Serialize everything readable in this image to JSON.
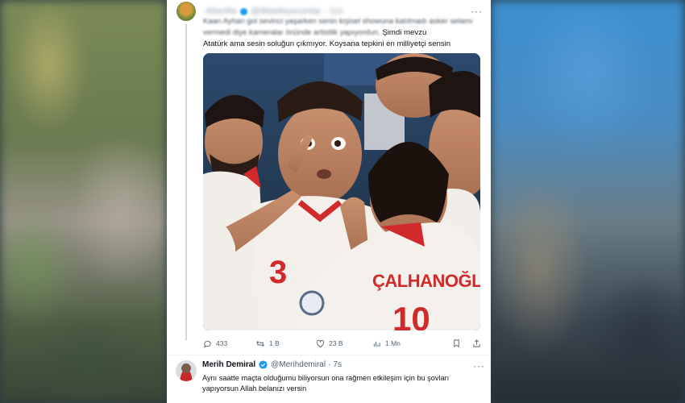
{
  "tweet1": {
    "author_blurred": "AltanRe",
    "handle_blurred": "@ilkbelleyorumlar · 11s",
    "text_blurred": "Kaan Ayhan gol sevinci yaşarken senin kişisel showuna katılmadı asker selamı vermedi diye kameralar önünde artistlik yapıyordun.",
    "text_line3_rest": "Şimdi mevzu",
    "text_line4": "Atatürk ama sesin soluğun çıkmıyor. Koysana tepkini en milliyetçi sensin",
    "media": {
      "jersey_numbers": [
        "3",
        "10"
      ],
      "jersey_name": "ÇALHANOĞLU"
    },
    "actions": {
      "replies": "433",
      "reposts": "1 B",
      "likes": "23 B",
      "views": "1 Mn"
    }
  },
  "tweet2": {
    "name": "Merih Demiral",
    "handle": "@Merihdemiral",
    "separator": "·",
    "time": "7s",
    "text": "Aynı saatte maçta olduğumu biliyorsun ona rağmen etkileşim için bu şovları yapıyorsun Allah belanızı versin"
  },
  "colors": {
    "verified": "#1d9bf0",
    "text": "#0f1419",
    "muted": "#536471"
  }
}
